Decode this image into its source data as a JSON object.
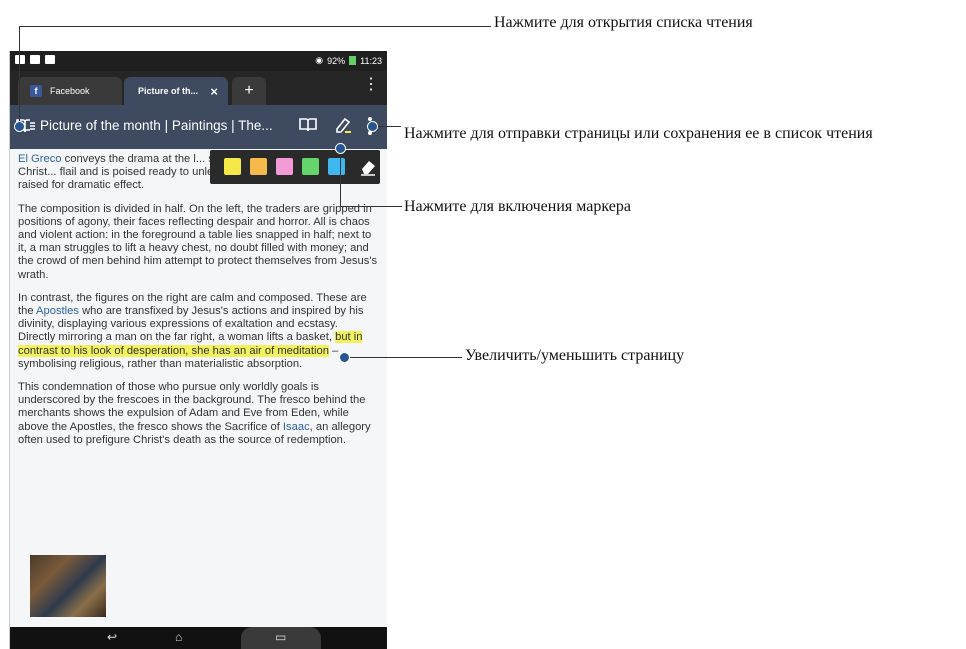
{
  "status_bar": {
    "battery": "92%",
    "time": "11:23"
  },
  "tabs": [
    {
      "label": "Facebook",
      "icon": "facebook-icon"
    },
    {
      "label": "Picture of th...",
      "close": "×"
    },
    {
      "label": "+"
    }
  ],
  "toolbar": {
    "title": "Picture of the month | Paintings | The..."
  },
  "article": {
    "p1_link": "El Greco",
    "p1_text": " conveys the drama at the l... shock of Christ being violent. Christ... flail and is poised ready to unleash it – his torso twisted and foot raised for dramatic effect.",
    "p2": "The composition is divided in half. On the left, the traders are gripped in positions of agony, their faces reflecting despair and horror. All is chaos and violent action: in the foreground a table lies snapped in half; next to it, a man struggles to lift a heavy chest, no doubt filled with money; and the crowd of men behind him attempt to protect themselves from Jesus's wrath.",
    "p3_a": "In contrast, the figures on the right are calm and composed. These are the ",
    "p3_link": "Apostles",
    "p3_b": " who are transfixed by Jesus's actions and inspired by his divinity, displaying various expressions of exaltation and ecstasy. Directly mirroring a man on the far right, a woman lifts a basket, ",
    "p3_hl": "but in contrast to his look of desperation, she has an air of meditation",
    "p3_c": " – symbolising religious, rather than materialistic absorption.",
    "p4_a": "This condemnation of those who pursue only worldly goals is underscored by the frescoes in the background. The fresco behind the merchants shows the expulsion of Adam and Eve from Eden, while above the Apostles, the fresco shows the Sacrifice of ",
    "p4_link": "Isaac",
    "p4_b": ", an allegory often used to prefigure Christ's death as the source of redemption."
  },
  "marker_palette": {
    "colors": [
      "#f5e94a",
      "#f6b94b",
      "#f29bd6",
      "#65d46a",
      "#3fb8f0"
    ]
  },
  "callouts": {
    "reading_list": "Нажмите для открытия списка чтения",
    "share": "Нажмите для отправки страницы или сохранения ее в список чтения",
    "marker": "Нажмите для включения маркера",
    "zoom": "Увеличить/уменьшить страницу"
  }
}
